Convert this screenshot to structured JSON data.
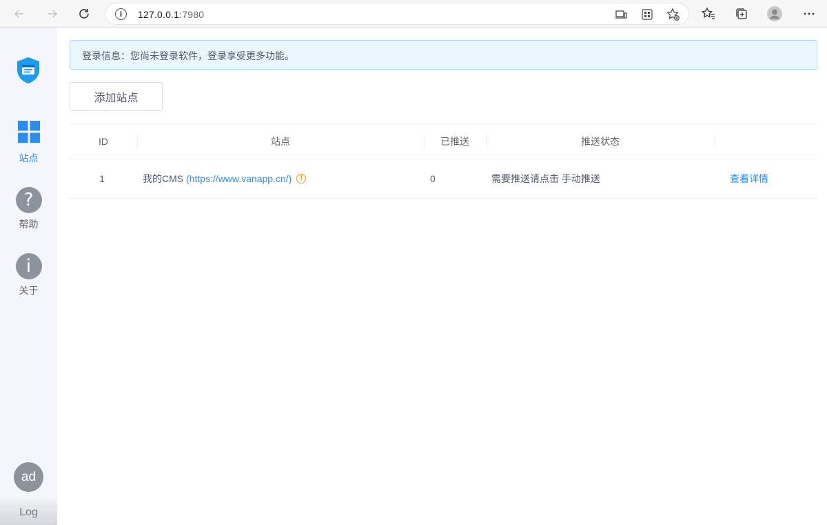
{
  "browser": {
    "url_host": "127.0.0.1",
    "url_port": ":7980"
  },
  "sidebar": {
    "items": [
      {
        "label": "站点",
        "icon": "grid-icon",
        "active": true
      },
      {
        "label": "帮助",
        "icon": "help-icon"
      },
      {
        "label": "关于",
        "icon": "info-icon"
      }
    ],
    "avatar_text": "ad",
    "log_label": "Log"
  },
  "alert": {
    "text": "登录信息：您尚未登录软件，登录享受更多功能。"
  },
  "toolbar": {
    "add_site_label": "添加站点"
  },
  "table": {
    "headers": [
      "ID",
      "站点",
      "已推送",
      "推送状态",
      ""
    ],
    "rows": [
      {
        "id": "1",
        "site_name": "我的CMS",
        "site_url": "(https://www.vanapp.cn/)",
        "pushed": "0",
        "status_text": "需要推送请点击",
        "status_link": "手动推送",
        "action": "查看详情"
      }
    ]
  },
  "colors": {
    "accent": "#2d8cf0",
    "warning": "#ff9900",
    "alert_bg": "#e8f6fe",
    "alert_border": "#abdcff",
    "sidebar_bg": "#f5f6fb"
  }
}
